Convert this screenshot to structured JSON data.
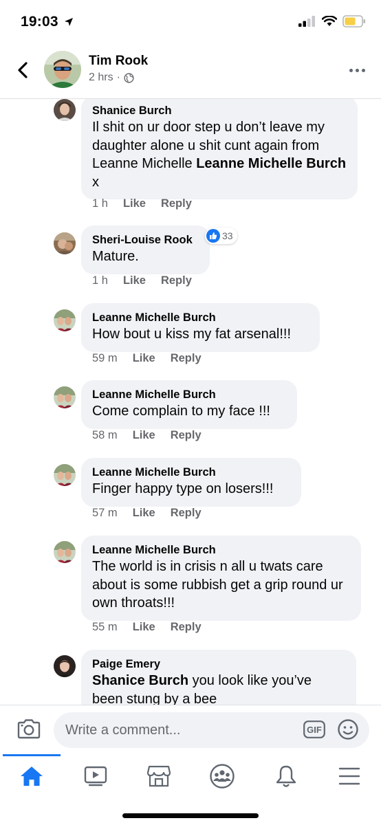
{
  "status_bar": {
    "time": "19:03"
  },
  "header": {
    "name": "Tim Rook",
    "time": "2 hrs",
    "separator": "·"
  },
  "comments": [
    {
      "author": "Shanice Burch",
      "text": "Il shit on ur door step u don’t leave my daughter alone u shit cunt again from Leanne Michelle ",
      "mention": "Leanne Michelle Burch",
      "after": " x",
      "time": "1 h",
      "like": "Like",
      "reply": "Reply"
    },
    {
      "author": "Sheri-Louise Rook",
      "text": "Mature.",
      "reactions": "33",
      "time": "1 h",
      "like": "Like",
      "reply": "Reply"
    },
    {
      "author": "Leanne Michelle Burch",
      "text": "How bout u kiss my fat arsenal!!!",
      "time": "59 m",
      "like": "Like",
      "reply": "Reply"
    },
    {
      "author": "Leanne Michelle Burch",
      "text": "Come complain to my face !!!",
      "time": "58 m",
      "like": "Like",
      "reply": "Reply"
    },
    {
      "author": "Leanne Michelle Burch",
      "text": "Finger happy type on losers!!!",
      "time": "57 m",
      "like": "Like",
      "reply": "Reply"
    },
    {
      "author": "Leanne Michelle Burch",
      "text": "The world is in crisis n all u twats care about is some rubbish get a grip round ur own throats!!!",
      "time": "55 m",
      "like": "Like",
      "reply": "Reply"
    },
    {
      "author": "Paige Emery",
      "mention": "Shanice Burch",
      "text": " you look like you’ve been stung by a bee"
    }
  ],
  "composer": {
    "placeholder": "Write a comment...",
    "gif_label": "GIF"
  },
  "tabs": [
    "home-icon",
    "watch-icon",
    "marketplace-icon",
    "groups-icon",
    "notifications-icon",
    "menu-icon"
  ],
  "colors": {
    "accent": "#1877f2",
    "bubble": "#f0f2f5",
    "meta": "#65676b"
  }
}
